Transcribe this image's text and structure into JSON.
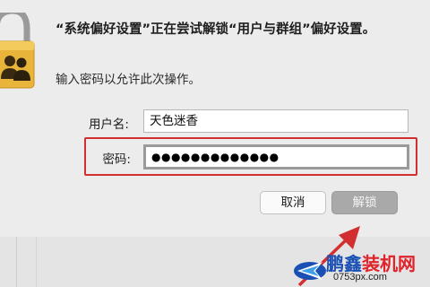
{
  "dialog": {
    "message": "“系统偏好设置”正在尝试解锁“用户与群组”偏好设置。",
    "prompt": "输入密码以允许此次操作。",
    "username_label": "用户名:",
    "username_value": "天色迷香",
    "password_label": "密码:",
    "password_value": "●●●●●●●●●●●●●",
    "cancel_label": "取消",
    "unlock_label": "解锁"
  },
  "watermark": {
    "brand_part1": "鹏鑫",
    "brand_part2": "装机网",
    "url": "0753px.com",
    "brand_color1": "#1a4fb3",
    "brand_color2": "#e0222b"
  },
  "colors": {
    "highlight_border": "#d23030",
    "arrow": "#d23030"
  },
  "icons": [
    "lock-icon",
    "users-icon"
  ]
}
